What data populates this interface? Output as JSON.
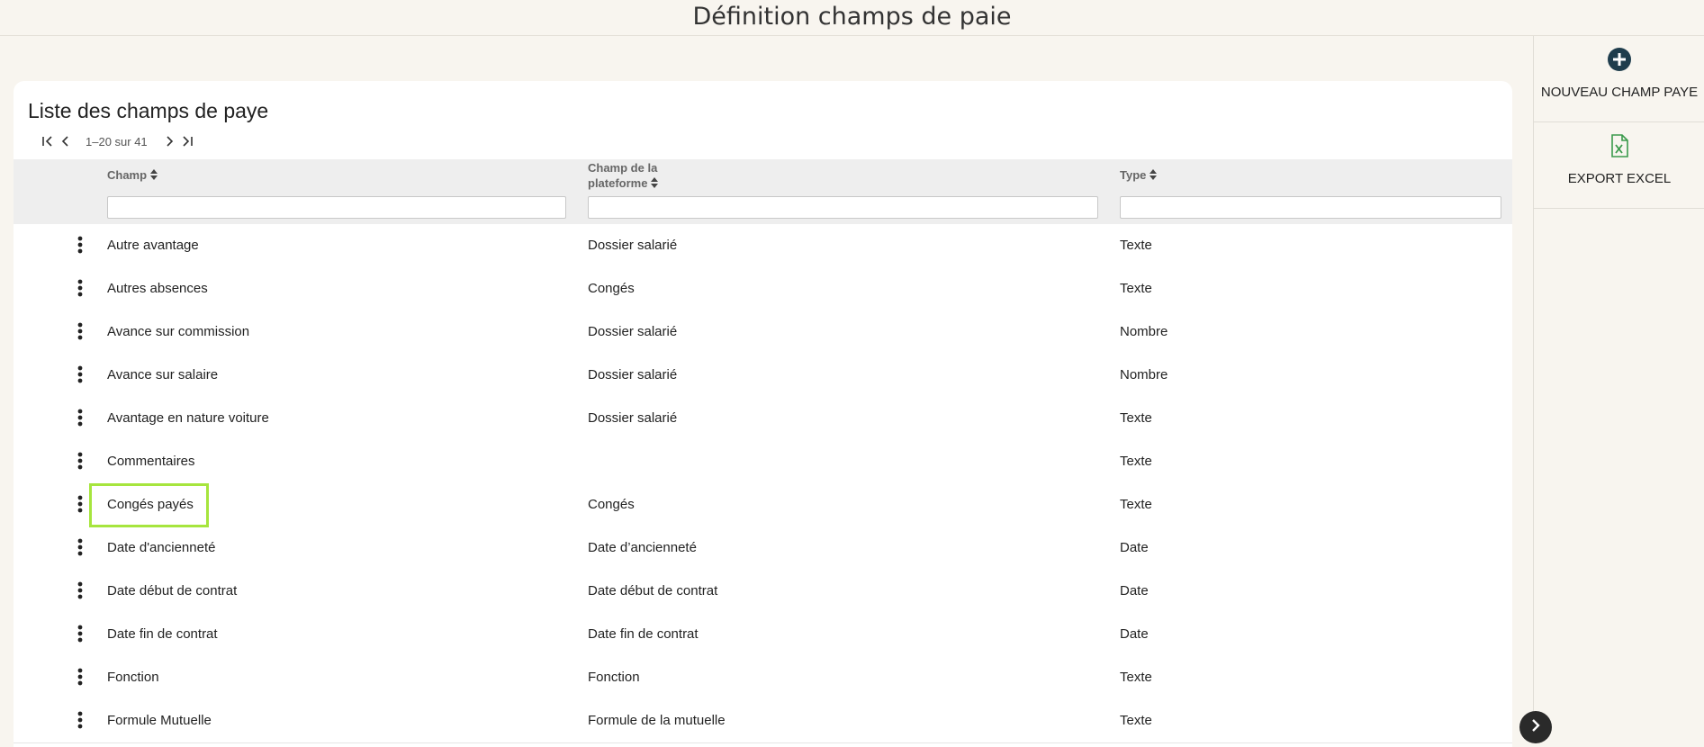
{
  "header": {
    "title": "Définition champs de paie"
  },
  "card": {
    "title": "Liste des champs de paye",
    "pager": {
      "range_text": "1–20 sur 41"
    }
  },
  "table": {
    "columns": [
      {
        "label": "Champ"
      },
      {
        "label_line1": "Champ de la",
        "label_line2": "plateforme"
      },
      {
        "label": "Type"
      }
    ],
    "rows": [
      {
        "champ": "Autre avantage",
        "plateforme": "Dossier salarié",
        "type": "Texte"
      },
      {
        "champ": "Autres absences",
        "plateforme": "Congés",
        "type": "Texte"
      },
      {
        "champ": "Avance sur commission",
        "plateforme": "Dossier salarié",
        "type": "Nombre"
      },
      {
        "champ": "Avance sur salaire",
        "plateforme": "Dossier salarié",
        "type": "Nombre"
      },
      {
        "champ": "Avantage en nature voiture",
        "plateforme": "Dossier salarié",
        "type": "Texte"
      },
      {
        "champ": "Commentaires",
        "plateforme": "",
        "type": "Texte"
      },
      {
        "champ": "Congés payés",
        "plateforme": "Congés",
        "type": "Texte"
      },
      {
        "champ": "Date d'ancienneté",
        "plateforme": "Date d’ancienneté",
        "type": "Date"
      },
      {
        "champ": "Date début de contrat",
        "plateforme": "Date début de contrat",
        "type": "Date"
      },
      {
        "champ": "Date fin de contrat",
        "plateforme": "Date fin de contrat",
        "type": "Date"
      },
      {
        "champ": "Fonction",
        "plateforme": "Fonction",
        "type": "Texte"
      },
      {
        "champ": "Formule Mutuelle",
        "plateforme": "Formule de la mutuelle",
        "type": "Texte"
      }
    ]
  },
  "sidebar": {
    "new_field_label": "NOUVEAU CHAMP PAYE",
    "export_label": "EXPORT EXCEL"
  },
  "colors": {
    "accent_dark": "#1f3d4d",
    "excel_green": "#3a9a4b",
    "highlight": "#a6e53d"
  },
  "icons": [
    "add-circle-icon",
    "excel-file-icon",
    "kebab-menu-icon",
    "sort-icon",
    "first-page-icon",
    "prev-page-icon",
    "next-page-icon",
    "last-page-icon",
    "chevron-right-icon"
  ]
}
